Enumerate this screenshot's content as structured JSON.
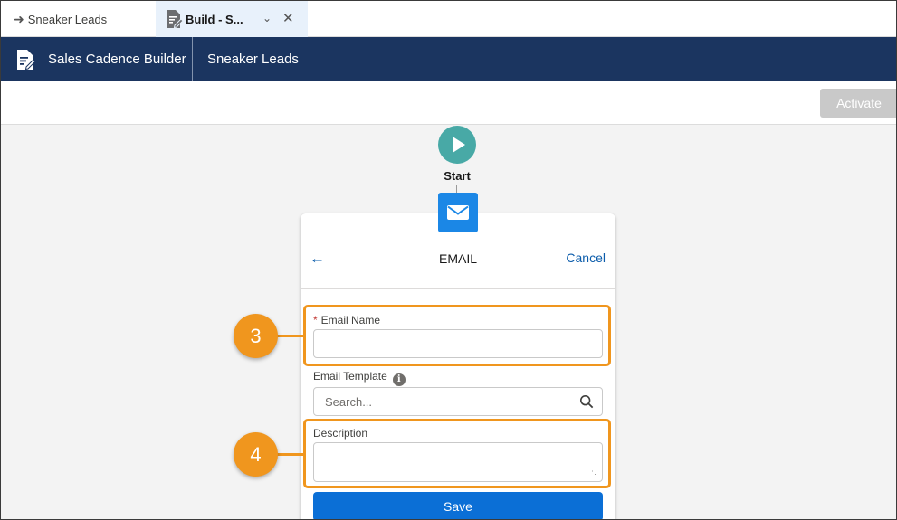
{
  "tabs": [
    {
      "label": "Sneaker Leads",
      "icon": "arrow-right-icon"
    },
    {
      "label": "Build - S...",
      "icon": "document-edit-icon",
      "active": true
    }
  ],
  "navbar": {
    "app_name": "Sales Cadence Builder",
    "record_name": "Sneaker Leads"
  },
  "toolbar": {
    "activate_label": "Activate"
  },
  "canvas": {
    "start_label": "Start"
  },
  "panel": {
    "title": "EMAIL",
    "cancel_label": "Cancel",
    "email_name": {
      "label": "Email Name",
      "required_mark": "*",
      "value": ""
    },
    "email_template": {
      "label": "Email Template",
      "placeholder": "Search...",
      "info_glyph": "i"
    },
    "description": {
      "label": "Description",
      "value": ""
    },
    "save_label": "Save"
  },
  "callouts": [
    "3",
    "4"
  ],
  "colors": {
    "navbar": "#1b3560",
    "accent": "#0b6fd6",
    "callout": "#f0961e",
    "start_node": "#48a9a6",
    "email_node": "#1b87e6"
  }
}
